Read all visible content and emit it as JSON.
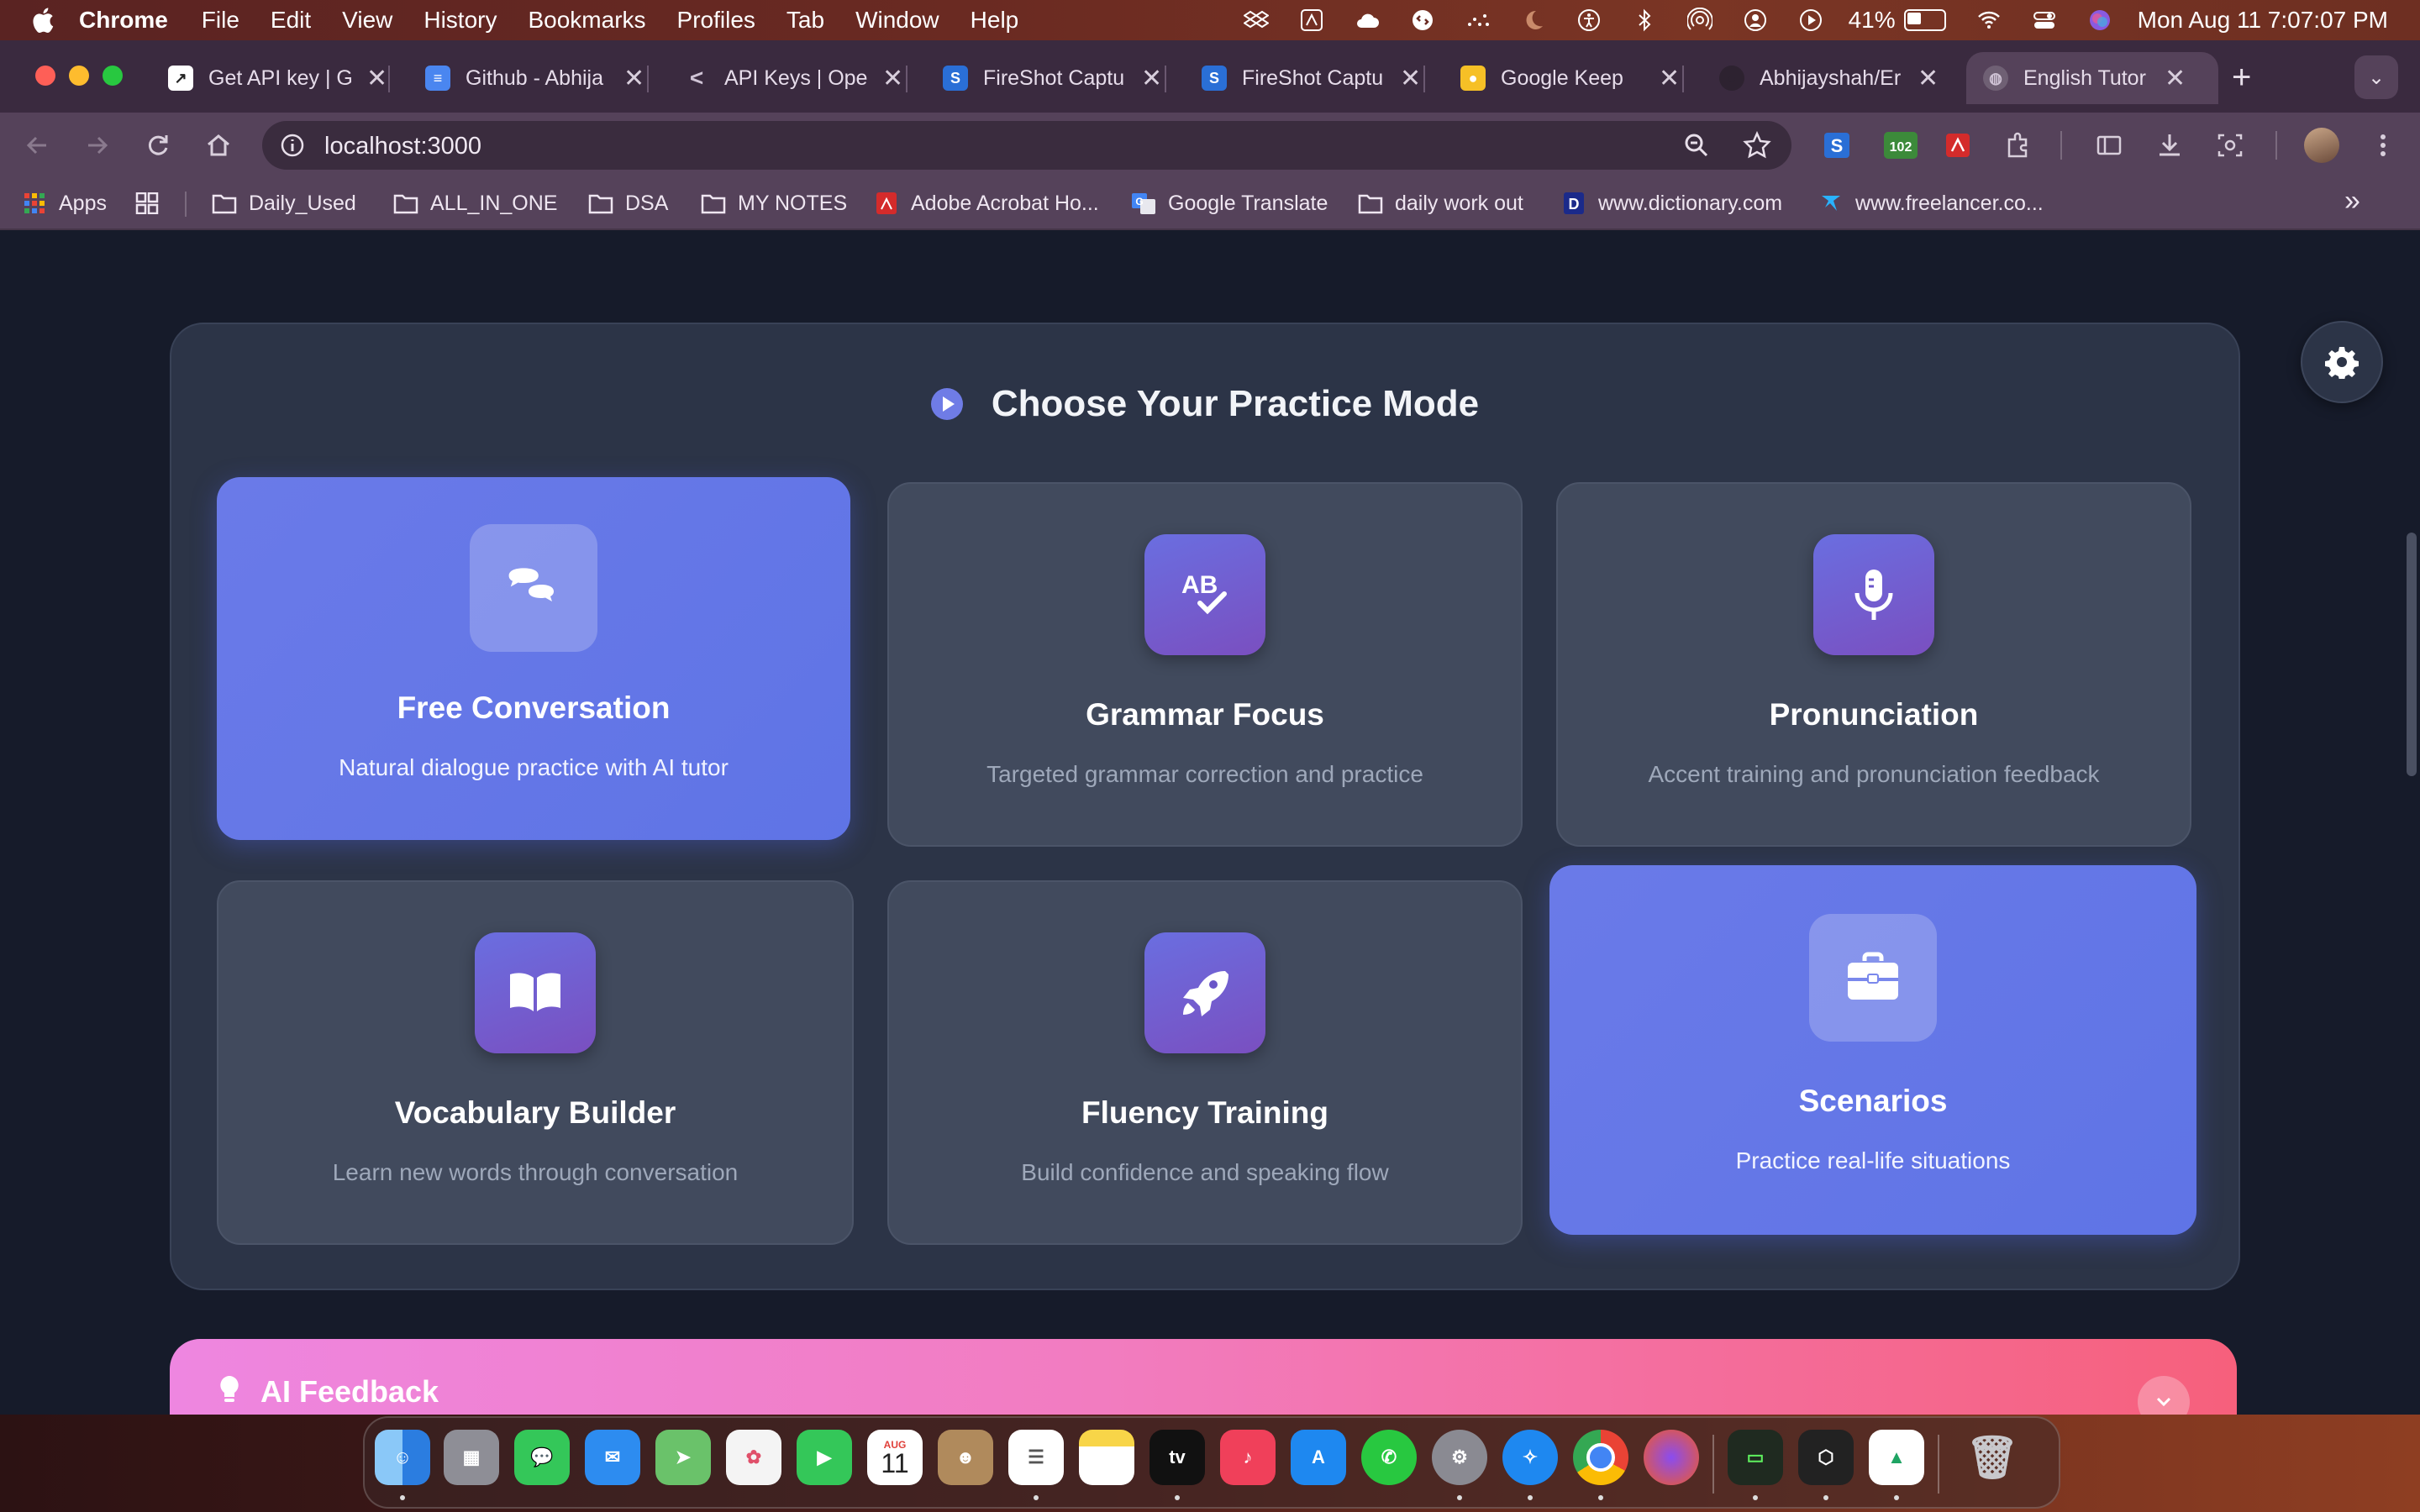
{
  "menubar": {
    "app": "Chrome",
    "items": [
      "File",
      "Edit",
      "View",
      "History",
      "Bookmarks",
      "Profiles",
      "Tab",
      "Window",
      "Help"
    ],
    "battery": "41%",
    "battery_level": 0.41,
    "clock": "Mon Aug 11  7:07:07 PM"
  },
  "tabs": [
    {
      "title": "Get API key | G",
      "favicon": "G"
    },
    {
      "title": "Github - Abhija",
      "favicon": "doc"
    },
    {
      "title": "API Keys | Ope",
      "favicon": "<"
    },
    {
      "title": "FireShot Captu",
      "favicon": "S"
    },
    {
      "title": "FireShot Captu",
      "favicon": "S"
    },
    {
      "title": "Google Keep",
      "favicon": "keep"
    },
    {
      "title": "Abhijayshah/Er",
      "favicon": "github"
    },
    {
      "title": "English Tutor A",
      "favicon": "globe",
      "active": true
    }
  ],
  "omnibox": {
    "url": "localhost:3000"
  },
  "extension_badge": "102",
  "bookmarks": [
    {
      "label": "Apps",
      "icon": "apps-grid-icon"
    },
    {
      "label": "",
      "icon": "tab-groups-icon"
    },
    {
      "label": "Daily_Used",
      "icon": "folder-icon"
    },
    {
      "label": "ALL_IN_ONE",
      "icon": "folder-icon"
    },
    {
      "label": "DSA",
      "icon": "folder-icon"
    },
    {
      "label": "MY NOTES",
      "icon": "folder-icon"
    },
    {
      "label": "Adobe Acrobat Ho...",
      "icon": "acrobat-icon"
    },
    {
      "label": "Google Translate",
      "icon": "translate-icon"
    },
    {
      "label": "daily work out",
      "icon": "folder-icon"
    },
    {
      "label": "www.dictionary.com",
      "icon": "dictionary-icon"
    },
    {
      "label": "www.freelancer.co...",
      "icon": "freelancer-icon"
    }
  ],
  "practice": {
    "title": "Choose Your Practice Mode",
    "modes": [
      {
        "title": "Free Conversation",
        "desc": "Natural dialogue practice with AI tutor",
        "icon": "chat-bubbles-icon",
        "selected": true
      },
      {
        "title": "Grammar Focus",
        "desc": "Targeted grammar correction and practice",
        "icon": "spellcheck-icon",
        "selected": false
      },
      {
        "title": "Pronunciation",
        "desc": "Accent training and pronunciation feedback",
        "icon": "microphone-icon",
        "selected": false
      },
      {
        "title": "Vocabulary Builder",
        "desc": "Learn new words through conversation",
        "icon": "book-icon",
        "selected": false
      },
      {
        "title": "Fluency Training",
        "desc": "Build confidence and speaking flow",
        "icon": "rocket-icon",
        "selected": false
      },
      {
        "title": "Scenarios",
        "desc": "Practice real-life situations",
        "icon": "briefcase-icon",
        "selected": true
      }
    ]
  },
  "feedback": {
    "title": "AI Feedback"
  },
  "dock": {
    "calendar_month": "AUG",
    "calendar_day": "11",
    "apps": [
      "Finder",
      "Launchpad",
      "Messages",
      "Mail",
      "Maps",
      "Photos",
      "FaceTime",
      "Calendar",
      "Contacts",
      "Reminders",
      "Notes",
      "TV",
      "Music",
      "App Store",
      "WhatsApp",
      "System Settings",
      "Safari",
      "Chrome",
      "Firefox",
      "Terminal",
      "Cube",
      "Google Drive",
      "Trash"
    ]
  },
  "colors": {
    "accent": "#6a7ae8",
    "card": "#414a5d",
    "panel": "#2c3447",
    "feedback_start": "#ee86e0",
    "feedback_end": "#f6607c"
  }
}
